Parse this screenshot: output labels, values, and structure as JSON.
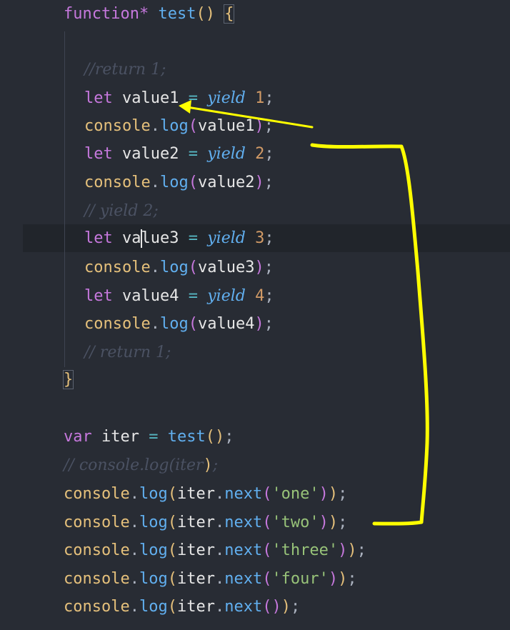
{
  "code": {
    "l1": {
      "kw": "function",
      "star": "*",
      "name": "test",
      "parens": "()",
      "brace": "{"
    },
    "l3": {
      "comment": "//return 1;"
    },
    "l4": {
      "kw": "let",
      "var": "value1",
      "eq": "=",
      "yield": "yield",
      "num": "1",
      "semi": ";"
    },
    "l5": {
      "obj": "console",
      "dot": ".",
      "fn": "log",
      "open": "(",
      "arg": "value1",
      "close": ")",
      "semi": ";"
    },
    "l6": {
      "kw": "let",
      "var": "value2",
      "eq": "=",
      "yield": "yield",
      "num": "2",
      "semi": ";"
    },
    "l7": {
      "obj": "console",
      "dot": ".",
      "fn": "log",
      "open": "(",
      "arg": "value2",
      "close": ")",
      "semi": ";"
    },
    "l8": {
      "comment": "// yield 2;"
    },
    "l9": {
      "kw": "let",
      "var_a": "va",
      "var_b": "lue3",
      "eq": "=",
      "yield": "yield",
      "num": "3",
      "semi": ";"
    },
    "l10": {
      "obj": "console",
      "dot": ".",
      "fn": "log",
      "open": "(",
      "arg": "value3",
      "close": ")",
      "semi": ";"
    },
    "l11": {
      "kw": "let",
      "var": "value4",
      "eq": "=",
      "yield": "yield",
      "num": "4",
      "semi": ";"
    },
    "l12": {
      "obj": "console",
      "dot": ".",
      "fn": "log",
      "open": "(",
      "arg": "value4",
      "close": ")",
      "semi": ";"
    },
    "l13": {
      "comment": "// return 1;"
    },
    "l14": {
      "brace": "}"
    },
    "l16": {
      "kw": "var",
      "var": "iter",
      "eq": "=",
      "fn": "test",
      "parens": "()",
      "semi": ";"
    },
    "l17": {
      "comment": "// console.log(iter",
      "close": ")",
      "semi": ";"
    },
    "l18": {
      "obj": "console",
      "dot": ".",
      "fn": "log",
      "open": "(",
      "iter": "iter",
      "dot2": ".",
      "next": "next",
      "open2": "(",
      "arg": "'one'",
      "close2": ")",
      "close": ")",
      "semi": ";"
    },
    "l19": {
      "obj": "console",
      "dot": ".",
      "fn": "log",
      "open": "(",
      "iter": "iter",
      "dot2": ".",
      "next": "next",
      "open2": "(",
      "arg": "'two'",
      "close2": ")",
      "close": ")",
      "semi": ";"
    },
    "l20": {
      "obj": "console",
      "dot": ".",
      "fn": "log",
      "open": "(",
      "iter": "iter",
      "dot2": ".",
      "next": "next",
      "open2": "(",
      "arg": "'three'",
      "close2": ")",
      "close": ")",
      "semi": ";"
    },
    "l21": {
      "obj": "console",
      "dot": ".",
      "fn": "log",
      "open": "(",
      "iter": "iter",
      "dot2": ".",
      "next": "next",
      "open2": "(",
      "arg": "'four'",
      "close2": ")",
      "close": ")",
      "semi": ";"
    },
    "l22": {
      "obj": "console",
      "dot": ".",
      "fn": "log",
      "open": "(",
      "iter": "iter",
      "dot2": ".",
      "next": "next",
      "open2": "(",
      "close2": ")",
      "close": ")",
      "semi": ";"
    }
  },
  "colors": {
    "background": "#282c34",
    "current_line": "#21252b",
    "annotation": "#ffff00"
  }
}
